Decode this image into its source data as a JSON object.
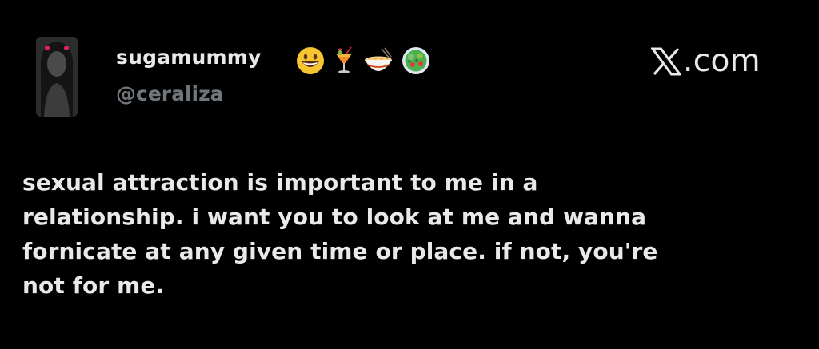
{
  "post": {
    "author": {
      "display_name": "sugamummy",
      "handle": "@ceraliza",
      "avatar_icon": "profile-photo",
      "name_emojis": [
        "grinning-face-icon",
        "tropical-drink-icon",
        "noodle-bowl-icon",
        "salad-bowl-icon"
      ]
    },
    "brand": {
      "icon": "x-logo-icon",
      "text": ".com"
    },
    "text": "sexual attraction is important to me in a\nrelationship. i want you to look at me and wanna\nfornicate at any given time or place. if not, you're\nnot for me."
  },
  "colors": {
    "background": "#000000",
    "primary_text": "#e7e9ea",
    "secondary_text": "#71767b"
  }
}
